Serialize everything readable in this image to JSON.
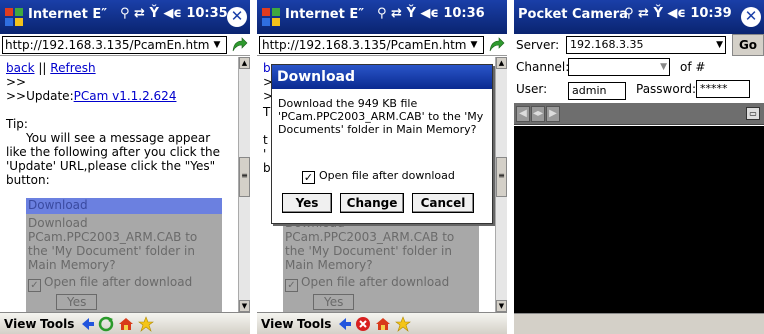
{
  "panel1": {
    "title": "Internet E″",
    "status": "⚙ ⇄ Y¦ ◄€ 10:35",
    "time": "10:35",
    "url": "http://192.168.3.135/PcamEn.htm",
    "back_link": "back",
    "separator": "||",
    "refresh_link": "Refresh",
    "line_gtgt": ">>",
    "update_prefix": ">>Update:",
    "update_link": "PCam v1.1.2.624",
    "tip": "Tip:",
    "tip_text": "You will see a message appear like the following after you click the 'Update' URL,please click the \"Yes\" button:",
    "example_title": "Download",
    "example_body": "Download PCam.PPC2003_ARM.CAB to the 'My Document' folder in Main Memory?",
    "example_check": "Open file after download",
    "example_yes": "Yes",
    "menu_view": "View",
    "menu_tools": "Tools"
  },
  "panel2": {
    "title": "Internet E″",
    "time": "10:36",
    "url": "http://192.168.3.135/PcamEn.htm",
    "dialog_title": "Download",
    "dialog_msg": "Download the 949 KB file 'PCam.PPC2003_ARM.CAB' to the 'My Documents' folder in Main Memory?",
    "dialog_check": "Open file after download",
    "btn_yes": "Yes",
    "btn_change": "Change",
    "btn_cancel": "Cancel",
    "example_body": "Download PCam.PPC2003_ARM.CAB to the 'My Document' folder in Main Memory?",
    "example_check": "Open file after download",
    "example_yes": "Yes",
    "menu_view": "View",
    "menu_tools": "Tools"
  },
  "panel3": {
    "title": "Pocket Camera",
    "time": "10:39",
    "server_label": "Server:",
    "server_value": "192.168.3.35",
    "go": "Go",
    "channel_label": "Channel:",
    "of": "of #",
    "user_label": "User:",
    "user_value": "admin",
    "password_label": "Password:",
    "password_value": "*****"
  },
  "colors": {
    "titlebar": "#0a2470",
    "link": "#0000cc",
    "video_bg": "#000000"
  }
}
